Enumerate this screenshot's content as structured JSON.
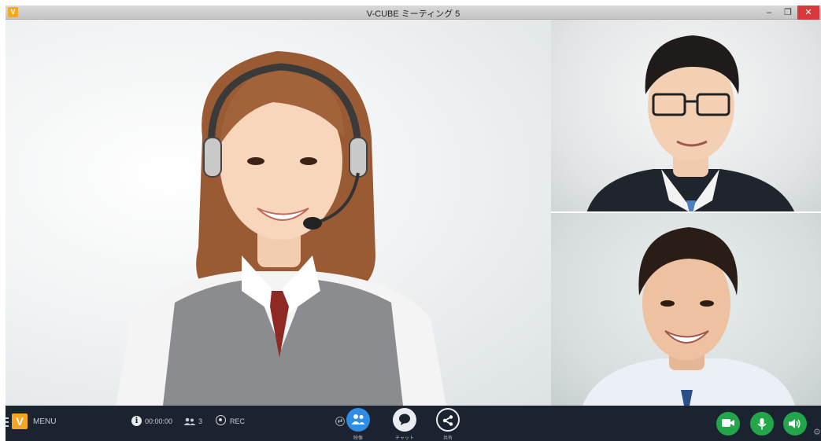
{
  "window": {
    "title": "V-CUBE ミーティング 5",
    "app_icon_letter": "V",
    "minimize_symbol": "–",
    "restore_symbol": "❐",
    "close_symbol": "✕"
  },
  "toolbar": {
    "menu_logo": "V",
    "menu_label": "MENU",
    "info_symbol": "i",
    "timer": "00:00:00",
    "participants_count": "3",
    "rec_label": "REC",
    "video_label": "映像",
    "chat_label": "チャット",
    "share_label": "共有"
  },
  "icons": {
    "hamburger": "hamburger-icon",
    "info": "info-icon",
    "participants": "participants-icon",
    "record": "record-icon",
    "swap": "swap-icon",
    "video": "video-participants-icon",
    "chat": "chat-bubble-icon",
    "share": "share-icon",
    "camera": "camera-icon",
    "microphone": "microphone-icon",
    "speaker": "speaker-icon",
    "settings": "gear-icon"
  },
  "colors": {
    "accent_orange": "#f5a623",
    "toolbar_bg": "#1b2230",
    "active_blue": "#2f8de4",
    "green": "#23a64a",
    "close_red": "#d9383a"
  }
}
